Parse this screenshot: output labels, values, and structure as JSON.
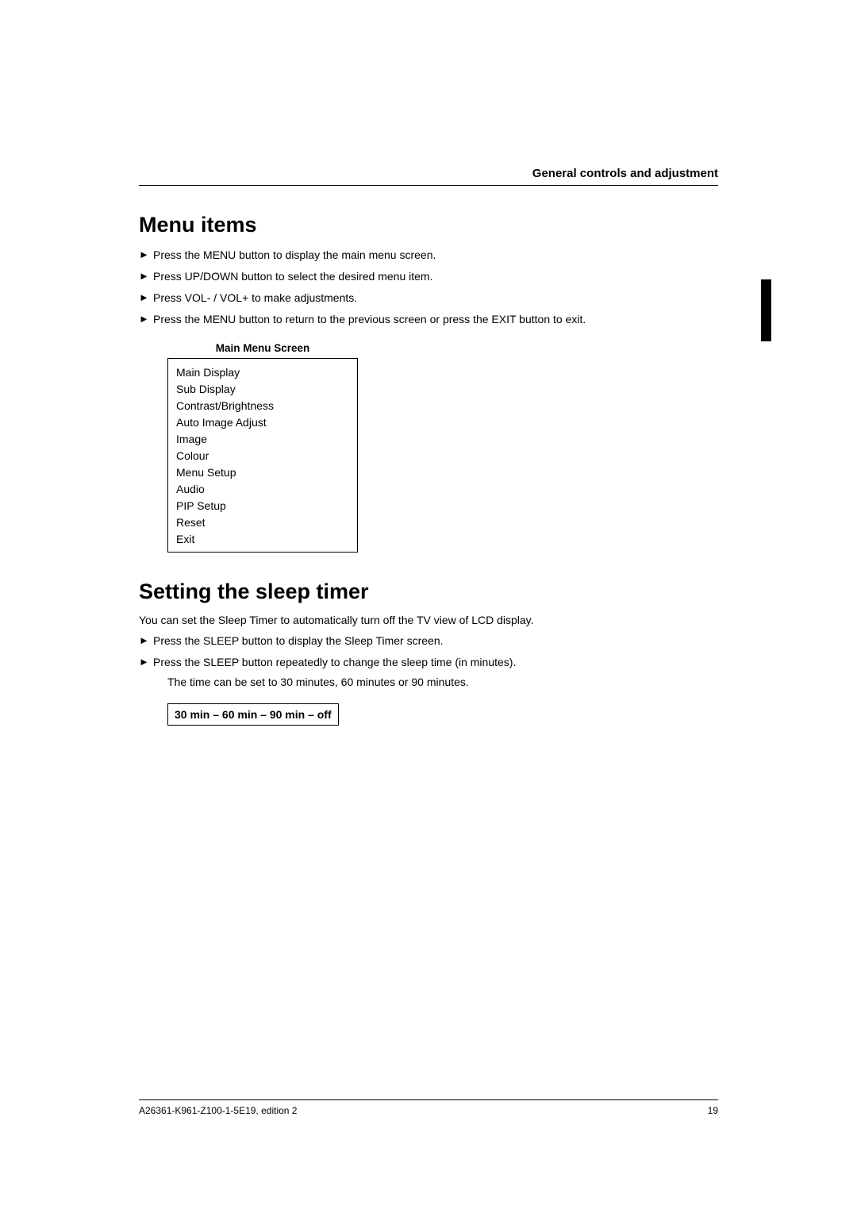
{
  "header": {
    "title": "General controls and adjustment"
  },
  "section1": {
    "heading": "Menu items",
    "steps": [
      "Press the MENU button to display the main menu screen.",
      "Press UP/DOWN  button to select the desired menu item.",
      "Press VOL- / VOL+ to make adjustments.",
      "Press the MENU button to return to the previous screen or press the EXIT button to exit."
    ],
    "menu_caption": "Main Menu Screen",
    "menu_items": [
      "Main Display",
      "Sub Display",
      "Contrast/Brightness",
      "Auto Image Adjust",
      "Image",
      "Colour",
      "Menu Setup",
      "Audio",
      "PIP Setup",
      "Reset",
      "Exit"
    ]
  },
  "section2": {
    "heading": "Setting the sleep timer",
    "intro": "You can set the Sleep Timer to automatically turn off the TV view of LCD display.",
    "steps": [
      "Press the SLEEP button to display the Sleep Timer screen.",
      "Press the SLEEP button repeatedly to change the sleep time (in minutes)."
    ],
    "note": "The time can be set to 30 minutes, 60 minutes or 90 minutes.",
    "box": "30 min – 60 min – 90 min – off"
  },
  "footer": {
    "left": "A26361-K961-Z100-1-5E19, edition 2",
    "right": "19"
  }
}
